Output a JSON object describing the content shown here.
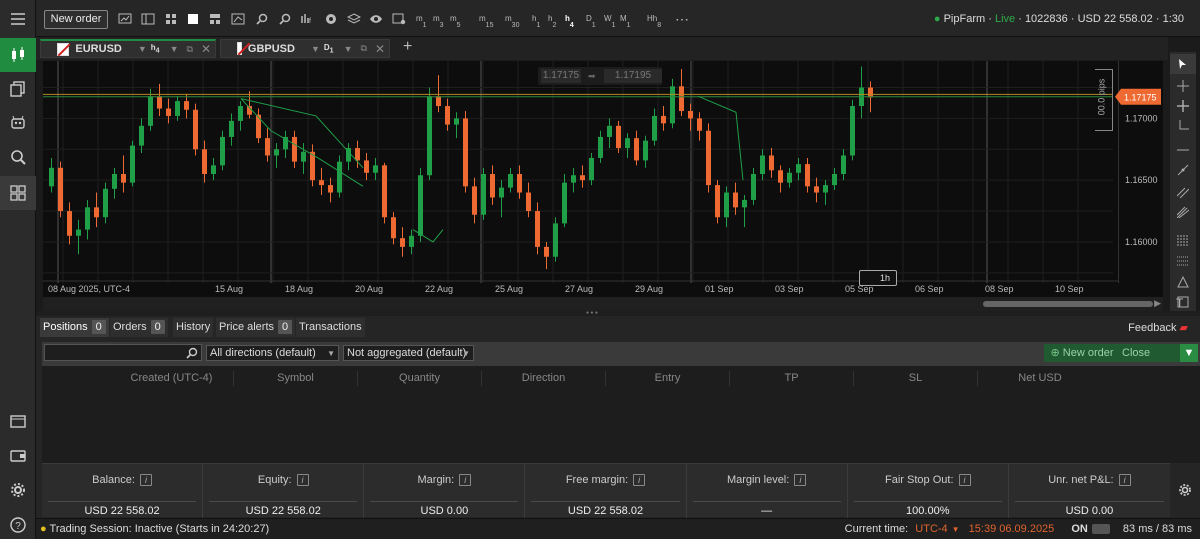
{
  "topbar": {
    "new_order_label": "New order",
    "timeframes": [
      {
        "main": "m",
        "sub": "1"
      },
      {
        "main": "m",
        "sub": "3"
      },
      {
        "main": "m",
        "sub": "5"
      },
      {
        "main": "m",
        "sub": "15"
      },
      {
        "main": "m",
        "sub": "30"
      },
      {
        "main": "h",
        "sub": "1"
      },
      {
        "main": "h",
        "sub": "2"
      },
      {
        "main": "h",
        "sub": "4"
      },
      {
        "main": "D",
        "sub": "1"
      },
      {
        "main": "W",
        "sub": "1"
      },
      {
        "main": "M",
        "sub": "1"
      },
      {
        "main": "Hh",
        "sub": "8"
      }
    ],
    "active_timeframe_index": 7,
    "account": {
      "broker": "PipFarm",
      "mode": "Live",
      "id": "1022836",
      "balance": "USD 22 558.02",
      "leverage": "1:30"
    }
  },
  "chart_tabs": [
    {
      "symbol": "EURUSD",
      "tf_main": "h",
      "tf_sub": "4"
    },
    {
      "symbol": "GBPUSD",
      "tf_main": "D",
      "tf_sub": "1"
    }
  ],
  "chart": {
    "bid_label": "1.17175",
    "ask_label": "1.17195",
    "current_price_label": "1.17175",
    "price_ticks": [
      {
        "label": "1.17000",
        "value": 1.17
      },
      {
        "label": "1.16500",
        "value": 1.165
      },
      {
        "label": "1.16000",
        "value": 1.16
      }
    ],
    "date_ticks": [
      "08 Aug 2025, UTC-4",
      "15 Aug",
      "18 Aug",
      "20 Aug",
      "22 Aug",
      "25 Aug",
      "27 Aug",
      "29 Aug",
      "01 Sep",
      "03 Sep",
      "05 Sep",
      "06 Sep",
      "08 Sep",
      "10 Sep"
    ],
    "pips_label": "00.0 pips",
    "interval_tooltip": "1h"
  },
  "chart_data": {
    "type": "candlestick",
    "symbol": "EURUSD",
    "ylim": [
      1.157,
      1.183
    ],
    "candles": [
      [
        1.1645,
        1.1668,
        1.164,
        1.166
      ],
      [
        1.166,
        1.1665,
        1.162,
        1.1625
      ],
      [
        1.1625,
        1.1632,
        1.1598,
        1.1605
      ],
      [
        1.1605,
        1.1618,
        1.159,
        1.161
      ],
      [
        1.161,
        1.1634,
        1.1602,
        1.1628
      ],
      [
        1.1628,
        1.164,
        1.1612,
        1.162
      ],
      [
        1.162,
        1.1648,
        1.1615,
        1.1643
      ],
      [
        1.1643,
        1.166,
        1.1635,
        1.1655
      ],
      [
        1.1655,
        1.167,
        1.164,
        1.1648
      ],
      [
        1.1648,
        1.1682,
        1.1645,
        1.1678
      ],
      [
        1.1678,
        1.17,
        1.1672,
        1.1694
      ],
      [
        1.1694,
        1.1724,
        1.169,
        1.1718
      ],
      [
        1.1718,
        1.1728,
        1.1702,
        1.1708
      ],
      [
        1.1708,
        1.1716,
        1.1696,
        1.1702
      ],
      [
        1.1702,
        1.1718,
        1.1698,
        1.1714
      ],
      [
        1.1714,
        1.172,
        1.17,
        1.1707
      ],
      [
        1.1707,
        1.1712,
        1.167,
        1.1675
      ],
      [
        1.1675,
        1.1682,
        1.1648,
        1.1655
      ],
      [
        1.1655,
        1.1668,
        1.165,
        1.1662
      ],
      [
        1.1662,
        1.169,
        1.1658,
        1.1685
      ],
      [
        1.1685,
        1.1704,
        1.1678,
        1.1698
      ],
      [
        1.1698,
        1.1714,
        1.169,
        1.171
      ],
      [
        1.171,
        1.1722,
        1.17,
        1.1703
      ],
      [
        1.1703,
        1.1708,
        1.168,
        1.1684
      ],
      [
        1.1684,
        1.1692,
        1.1665,
        1.167
      ],
      [
        1.167,
        1.168,
        1.166,
        1.1675
      ],
      [
        1.1675,
        1.169,
        1.1668,
        1.1685
      ],
      [
        1.1685,
        1.169,
        1.166,
        1.1665
      ],
      [
        1.1665,
        1.168,
        1.1655,
        1.1673
      ],
      [
        1.1673,
        1.1679,
        1.1645,
        1.165
      ],
      [
        1.165,
        1.166,
        1.1638,
        1.1646
      ],
      [
        1.1646,
        1.1652,
        1.1632,
        1.164
      ],
      [
        1.164,
        1.167,
        1.1636,
        1.1665
      ],
      [
        1.1665,
        1.168,
        1.1658,
        1.1676
      ],
      [
        1.1676,
        1.1682,
        1.166,
        1.1666
      ],
      [
        1.1666,
        1.1672,
        1.165,
        1.1656
      ],
      [
        1.1656,
        1.1668,
        1.165,
        1.1662
      ],
      [
        1.1662,
        1.1664,
        1.1615,
        1.162
      ],
      [
        1.162,
        1.1624,
        1.1598,
        1.1603
      ],
      [
        1.1603,
        1.1612,
        1.1588,
        1.1596
      ],
      [
        1.1596,
        1.161,
        1.159,
        1.1605
      ],
      [
        1.1605,
        1.166,
        1.16,
        1.1654
      ],
      [
        1.1654,
        1.1725,
        1.165,
        1.1718
      ],
      [
        1.1718,
        1.1735,
        1.1705,
        1.171
      ],
      [
        1.171,
        1.1716,
        1.169,
        1.1695
      ],
      [
        1.1695,
        1.1705,
        1.1684,
        1.17
      ],
      [
        1.17,
        1.1706,
        1.164,
        1.1645
      ],
      [
        1.1645,
        1.1652,
        1.1615,
        1.1622
      ],
      [
        1.1622,
        1.166,
        1.1618,
        1.1655
      ],
      [
        1.1655,
        1.1662,
        1.163,
        1.1636
      ],
      [
        1.1636,
        1.165,
        1.162,
        1.1644
      ],
      [
        1.1644,
        1.166,
        1.164,
        1.1655
      ],
      [
        1.1655,
        1.1662,
        1.1635,
        1.164
      ],
      [
        1.164,
        1.1648,
        1.162,
        1.1625
      ],
      [
        1.1625,
        1.1632,
        1.159,
        1.1596
      ],
      [
        1.1596,
        1.16,
        1.1578,
        1.1588
      ],
      [
        1.1588,
        1.162,
        1.1584,
        1.1615
      ],
      [
        1.1615,
        1.1655,
        1.1612,
        1.1648
      ],
      [
        1.1648,
        1.166,
        1.164,
        1.1654
      ],
      [
        1.1654,
        1.1662,
        1.1644,
        1.165
      ],
      [
        1.165,
        1.1672,
        1.1646,
        1.1668
      ],
      [
        1.1668,
        1.169,
        1.1664,
        1.1685
      ],
      [
        1.1685,
        1.17,
        1.1676,
        1.1694
      ],
      [
        1.1694,
        1.1698,
        1.1672,
        1.1676
      ],
      [
        1.1676,
        1.1688,
        1.1668,
        1.1684
      ],
      [
        1.1684,
        1.169,
        1.1662,
        1.1666
      ],
      [
        1.1666,
        1.1686,
        1.166,
        1.1682
      ],
      [
        1.1682,
        1.1708,
        1.1678,
        1.1702
      ],
      [
        1.1702,
        1.171,
        1.169,
        1.1696
      ],
      [
        1.1696,
        1.1732,
        1.1692,
        1.1726
      ],
      [
        1.1726,
        1.174,
        1.1702,
        1.1706
      ],
      [
        1.1706,
        1.1712,
        1.169,
        1.17
      ],
      [
        1.17,
        1.1705,
        1.1682,
        1.169
      ],
      [
        1.169,
        1.1696,
        1.164,
        1.1646
      ],
      [
        1.1646,
        1.165,
        1.1615,
        1.162
      ],
      [
        1.162,
        1.1645,
        1.1612,
        1.164
      ],
      [
        1.164,
        1.1648,
        1.1622,
        1.1628
      ],
      [
        1.1628,
        1.1638,
        1.1612,
        1.1634
      ],
      [
        1.1634,
        1.166,
        1.163,
        1.1655
      ],
      [
        1.1655,
        1.1675,
        1.165,
        1.167
      ],
      [
        1.167,
        1.1676,
        1.1652,
        1.1658
      ],
      [
        1.1658,
        1.1662,
        1.164,
        1.1648
      ],
      [
        1.1648,
        1.166,
        1.1644,
        1.1656
      ],
      [
        1.1656,
        1.1668,
        1.165,
        1.1663
      ],
      [
        1.1663,
        1.1668,
        1.164,
        1.1645
      ],
      [
        1.1645,
        1.1652,
        1.1632,
        1.164
      ],
      [
        1.164,
        1.165,
        1.163,
        1.1646
      ],
      [
        1.1646,
        1.166,
        1.1642,
        1.1655
      ],
      [
        1.1655,
        1.1675,
        1.165,
        1.167
      ],
      [
        1.167,
        1.1715,
        1.1666,
        1.171
      ],
      [
        1.171,
        1.1742,
        1.17,
        1.1725
      ],
      [
        1.1725,
        1.173,
        1.1705,
        1.1717
      ]
    ],
    "levels": [
      1.17175,
      1.17195
    ]
  },
  "bottom": {
    "tabs": [
      {
        "label": "Positions",
        "count": "0"
      },
      {
        "label": "Orders",
        "count": "0"
      },
      {
        "label": "History",
        "count": ""
      },
      {
        "label": "Price alerts",
        "count": "0"
      },
      {
        "label": "Transactions",
        "count": ""
      }
    ],
    "feedback_label": "Feedback",
    "filter_direction": "All directions (default)",
    "filter_aggregation": "Not aggregated (default)",
    "new_order_label": "New order",
    "close_label": "Close (Disabled)",
    "columns": [
      "Created (UTC-4)",
      "Symbol",
      "Quantity",
      "Direction",
      "Entry",
      "TP",
      "SL",
      "Net USD"
    ],
    "summary": [
      {
        "label": "Balance:",
        "value": "USD 22 558.02"
      },
      {
        "label": "Equity:",
        "value": "USD 22 558.02"
      },
      {
        "label": "Margin:",
        "value": "USD 0.00"
      },
      {
        "label": "Free margin:",
        "value": "USD 22 558.02"
      },
      {
        "label": "Margin level:",
        "value": "—"
      },
      {
        "label": "Fair Stop Out:",
        "value": "100.00%"
      },
      {
        "label": "Unr. net P&L:",
        "value": "USD 0.00"
      }
    ]
  },
  "status": {
    "session": "Trading Session: Inactive (Starts in 24:20:27)",
    "current_time_label": "Current time:",
    "timezone": "UTC-4",
    "time": "15:39 06.09.2025",
    "toggle_label": "ON",
    "latency": "83 ms / 83 ms"
  },
  "colors": {
    "bull": "#1f9f48",
    "bear": "#ee6a32",
    "accent": "#2eaa4a",
    "level": "#b08a20"
  }
}
